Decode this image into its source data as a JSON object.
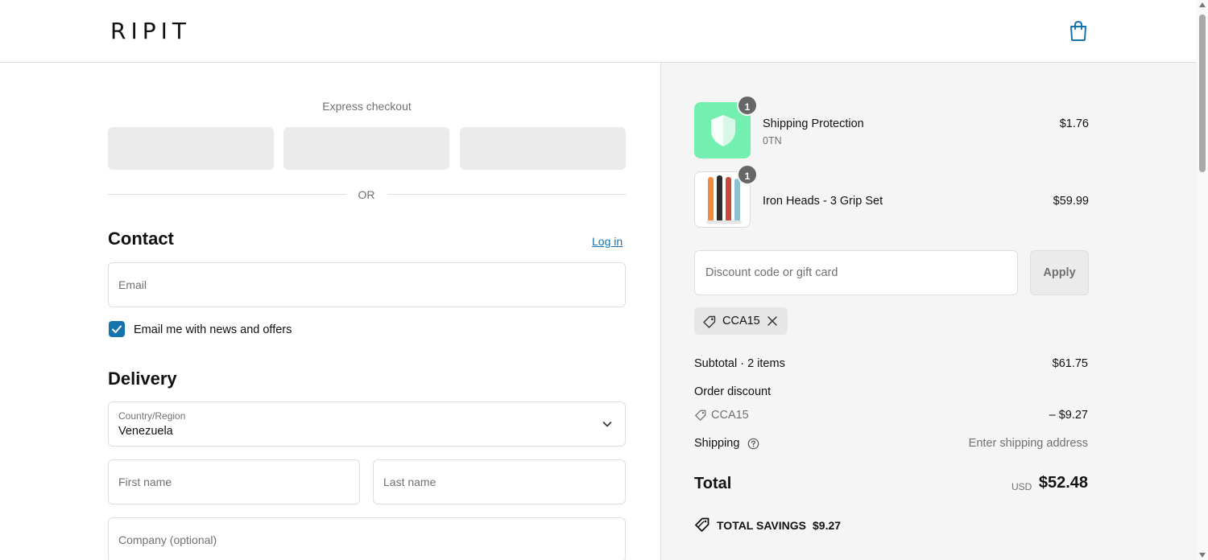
{
  "header": {
    "logo": "RIPIT",
    "cart_icon": "shopping-bag-icon"
  },
  "express": {
    "label": "Express checkout",
    "or_text": "OR"
  },
  "contact": {
    "title": "Contact",
    "login_link": "Log in",
    "email_placeholder": "Email",
    "newsletter_label": "Email me with news and offers",
    "newsletter_checked": true
  },
  "delivery": {
    "title": "Delivery",
    "country_label": "Country/Region",
    "country_value": "Venezuela",
    "first_name_placeholder": "First name",
    "last_name_placeholder": "Last name",
    "company_placeholder": "Company (optional)"
  },
  "summary": {
    "items": [
      {
        "name": "Shipping Protection",
        "variant": "0TN",
        "price": "$1.76",
        "quantity": "1"
      },
      {
        "name": "Iron Heads - 3 Grip Set",
        "variant": "",
        "price": "$59.99",
        "quantity": "1"
      }
    ],
    "discount_placeholder": "Discount code or gift card",
    "apply_label": "Apply",
    "applied_code": "CCA15",
    "subtotal_label": "Subtotal · 2 items",
    "subtotal_value": "$61.75",
    "order_discount_label": "Order discount",
    "discount_code": "CCA15",
    "discount_value": "– $9.27",
    "shipping_label": "Shipping",
    "shipping_value": "Enter shipping address",
    "total_label": "Total",
    "total_currency": "USD",
    "total_value": "$52.48",
    "savings_label": "TOTAL SAVINGS",
    "savings_value": "$9.27"
  },
  "colors": {
    "accent": "#1773b0",
    "shield_bg": "#73f0b0",
    "panel_bg": "#f5f5f5"
  }
}
